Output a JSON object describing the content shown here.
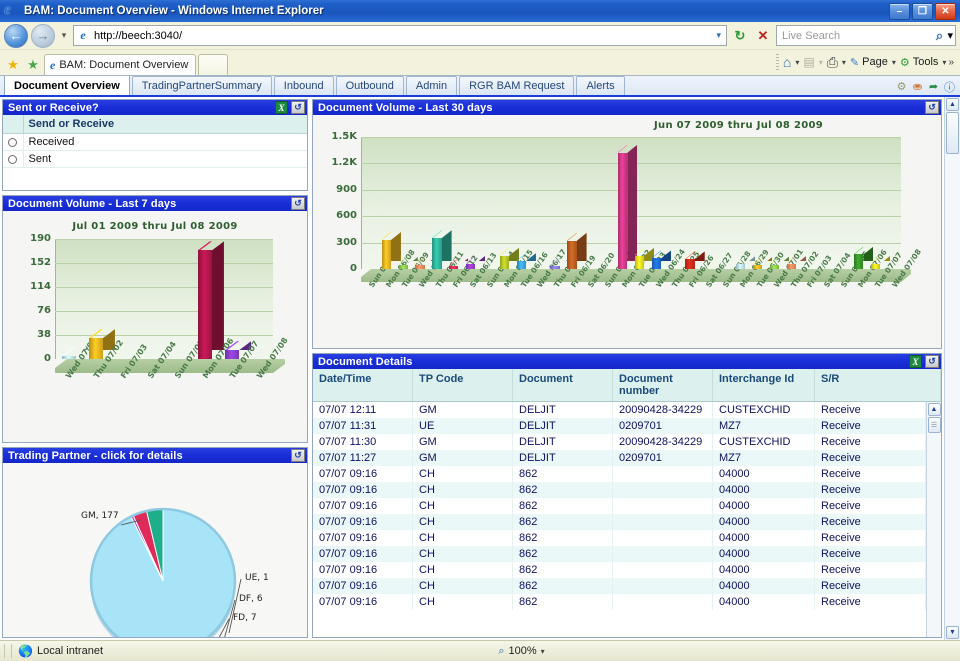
{
  "window": {
    "title": "BAM: Document Overview - Windows Internet Explorer",
    "minimize_label": "–",
    "restore_label": "❐",
    "close_label": "✕"
  },
  "browser": {
    "back_label": "←",
    "forward_label": "→",
    "history_caret": "▾",
    "url": "http://beech:3040/",
    "url_dropdown_caret": "▾",
    "refresh_label": "↻",
    "stop_label": "✕",
    "search_placeholder": "Live Search",
    "search_go_label": "⌕",
    "search_caret": "▾",
    "tab_title": "BAM: Document Overview",
    "new_tab_label": "",
    "favorites_add_label": "★",
    "favorites_center_label": "★",
    "command_bar": {
      "home_label": "⌂",
      "home_caret": "▾",
      "feeds_label": "▤",
      "feeds_caret": "▾",
      "print_label": "⎙",
      "print_caret": "▾",
      "page_label": "Page",
      "page_caret": "▾",
      "tools_label": "Tools",
      "tools_caret": "▾",
      "overflow_label": "»"
    }
  },
  "app_tabs": {
    "items": [
      {
        "label": "Document Overview",
        "active": true
      },
      {
        "label": "TradingPartnerSummary",
        "active": false
      },
      {
        "label": "Inbound",
        "active": false
      },
      {
        "label": "Outbound",
        "active": false
      },
      {
        "label": "Admin",
        "active": false
      },
      {
        "label": "RGR BAM Request",
        "active": false
      },
      {
        "label": "Alerts",
        "active": false
      }
    ],
    "icons": [
      "gear-icon",
      "user-icon",
      "logout-icon",
      "help-icon"
    ]
  },
  "panels": {
    "sent_or_receive": {
      "title": "Sent or Receive?",
      "export_icon": "X",
      "refresh_icon": "↺",
      "column_header": "Send or Receive",
      "rows": [
        "Received",
        "Sent"
      ]
    },
    "volume7": {
      "title_prefix": "Document Volume",
      "title_suffix": " - Last 7 days",
      "refresh_icon": "↺"
    },
    "volume30": {
      "title_prefix": "Document Volume",
      "title_suffix": " - Last 30 days",
      "refresh_icon": "↺"
    },
    "trading_partner": {
      "title": "Trading Partner - click for details",
      "refresh_icon": "↺"
    },
    "document_details": {
      "title": "Document Details",
      "export_icon": "X",
      "refresh_icon": "↺"
    }
  },
  "chart_data": [
    {
      "id": "volume7",
      "type": "bar",
      "title": "Jul 01 2009 thru Jul 08 2009",
      "xlabel": "",
      "ylabel": "",
      "ylim": [
        0,
        190
      ],
      "yticks": [
        0,
        38,
        76,
        114,
        152,
        190
      ],
      "grid": true,
      "legend": "none",
      "categories": [
        "Wed 07/01",
        "Thu 07/02",
        "Fri 07/03",
        "Sat 07/04",
        "Sun 07/05",
        "Mon 07/06",
        "Tue 07/07",
        "Wed 07/08"
      ],
      "values": [
        4,
        33,
        0,
        0,
        0,
        172,
        14,
        0
      ],
      "colors": [
        "#bfe4f5",
        "#e8b820",
        "#8fd14f",
        "#f08a5d",
        "#2fb8a0",
        "#b5164e",
        "#8c3fd0",
        "#6abf3a"
      ]
    },
    {
      "id": "volume30",
      "type": "bar",
      "title": "Jun 07 2009 thru Jul 08 2009",
      "xlabel": "",
      "ylabel": "",
      "ylim": [
        0,
        1500
      ],
      "yticks": [
        0,
        300,
        600,
        900,
        1200,
        1500
      ],
      "ytick_labels": [
        "0",
        "300",
        "600",
        "900",
        "1.2K",
        "1.5K"
      ],
      "grid": true,
      "legend": "none",
      "categories": [
        "Sun 06/07",
        "Mon 06/08",
        "Tue 06/09",
        "Wed 06/10",
        "Thu 06/11",
        "Fri 06/12",
        "Sat 06/13",
        "Sun 06/14",
        "Mon 06/15",
        "Tue 06/16",
        "Wed 06/17",
        "Thu 06/18",
        "Fri 06/19",
        "Sat 06/20",
        "Sun 06/21",
        "Mon 06/22",
        "Tue 06/23",
        "Wed 06/24",
        "Thu 06/25",
        "Fri 06/26",
        "Sat 06/27",
        "Sun 06/28",
        "Mon 06/29",
        "Tue 06/30",
        "Wed 07/01",
        "Thu 07/02",
        "Fri 07/03",
        "Sat 07/04",
        "Sun 07/05",
        "Mon 07/06",
        "Tue 07/07",
        "Wed 07/08"
      ],
      "values": [
        0,
        330,
        45,
        40,
        350,
        30,
        60,
        0,
        150,
        90,
        0,
        30,
        320,
        0,
        0,
        1320,
        150,
        120,
        0,
        110,
        0,
        0,
        55,
        45,
        50,
        55,
        0,
        0,
        0,
        165,
        60,
        0
      ],
      "colors": [
        "#e8b820",
        "#e8b820",
        "#8fd14f",
        "#f08a5d",
        "#2fb8a0",
        "#e02a5a",
        "#9b3fd0",
        "#bfe4f5",
        "#b9c929",
        "#3aa8e8",
        "#e8b820",
        "#8c7fe0",
        "#c06020",
        "#e8b820",
        "#e8b820",
        "#d63a8a",
        "#e8e020",
        "#1f6fd8",
        "#e8a020",
        "#d02a1a",
        "#e8b820",
        "#bfe4f5",
        "#bfe4f5",
        "#e8b820",
        "#8fd14f",
        "#f08a5d",
        "#e8b820",
        "#e8b820",
        "#e8b820",
        "#3a9a2a",
        "#e8e020",
        "#e8b820"
      ]
    },
    {
      "id": "trading_partner",
      "type": "pie",
      "title": "",
      "labels": [
        "GM",
        "UE",
        "DF",
        "FD"
      ],
      "label_texts": [
        "GM, 177",
        "UE, 1",
        "DF, 6",
        "FD, 7"
      ],
      "values": [
        177,
        1,
        6,
        7
      ],
      "colors": [
        "#a8e4f8",
        "#9b3fd0",
        "#e02a5a",
        "#1fae8a"
      ]
    }
  ],
  "document_details": {
    "columns": [
      "Date/Time",
      "TP Code",
      "Document",
      "Document\nnumber",
      "Interchange Id",
      "S/R"
    ],
    "column_labels": [
      "Date/Time",
      "TP Code",
      "Document",
      "Document number",
      "Interchange Id",
      "S/R"
    ],
    "rows": [
      [
        "07/07 12:11",
        "GM",
        "DELJIT",
        "20090428-34229",
        "CUSTEXCHID",
        "Receive"
      ],
      [
        "07/07 11:31",
        "UE",
        "DELJIT",
        "0209701",
        "MZ7",
        "Receive"
      ],
      [
        "07/07 11:30",
        "GM",
        "DELJIT",
        "20090428-34229",
        "CUSTEXCHID",
        "Receive"
      ],
      [
        "07/07 11:27",
        "GM",
        "DELJIT",
        "0209701",
        "MZ7",
        "Receive"
      ],
      [
        "07/07 09:16",
        "CH",
        "862",
        "",
        "04000",
        "Receive"
      ],
      [
        "07/07 09:16",
        "CH",
        "862",
        "",
        "04000",
        "Receive"
      ],
      [
        "07/07 09:16",
        "CH",
        "862",
        "",
        "04000",
        "Receive"
      ],
      [
        "07/07 09:16",
        "CH",
        "862",
        "",
        "04000",
        "Receive"
      ],
      [
        "07/07 09:16",
        "CH",
        "862",
        "",
        "04000",
        "Receive"
      ],
      [
        "07/07 09:16",
        "CH",
        "862",
        "",
        "04000",
        "Receive"
      ],
      [
        "07/07 09:16",
        "CH",
        "862",
        "",
        "04000",
        "Receive"
      ],
      [
        "07/07 09:16",
        "CH",
        "862",
        "",
        "04000",
        "Receive"
      ],
      [
        "07/07 09:16",
        "CH",
        "862",
        "",
        "04000",
        "Receive"
      ]
    ],
    "scroll_up_label": "▲",
    "scroll_down_label": "▼"
  },
  "status_bar": {
    "zone_text": "Local intranet",
    "zone_icon": "globe-shield-icon",
    "zoom_icon": "magnifier-icon",
    "zoom_level": "100%",
    "zoom_caret": "▾"
  }
}
